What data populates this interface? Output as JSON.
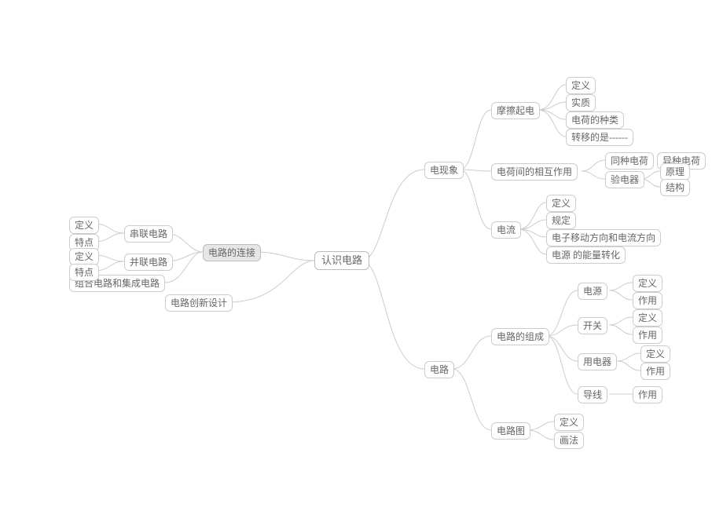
{
  "root": {
    "label": "认识电路"
  },
  "left": {
    "connection": {
      "label": "电路的连接",
      "series": {
        "label": "串联电路",
        "def": "定义",
        "char": "特点"
      },
      "parallel": {
        "label": "并联电路",
        "def": "定义",
        "char": "特点"
      },
      "combo": "组合电路和集成电路"
    },
    "innovate": "电路创新设计"
  },
  "right": {
    "phenomena": {
      "label": "电现象",
      "friction": {
        "label": "摩擦起电",
        "a": "定义",
        "b": "实质",
        "c": "电荷的种类",
        "d": "转移的是------"
      },
      "interaction": {
        "label": "电荷间的相互作用",
        "samecharge": "同种电荷",
        "diffcharge": "异种电荷",
        "electroscope": {
          "label": "验电器",
          "principle": "原理",
          "structure": "结构"
        }
      },
      "current": {
        "label": "电流",
        "a": "定义",
        "b": "规定",
        "c": "电子移动方向和电流方向",
        "d": "电源 的能量转化"
      }
    },
    "circuit": {
      "label": "电路",
      "composition": {
        "label": "电路的组成",
        "source": {
          "label": "电源",
          "def": "定义",
          "role": "作用"
        },
        "switch": {
          "label": "开关",
          "def": "定义",
          "role": "作用"
        },
        "device": {
          "label": "用电器",
          "def": "定义",
          "role": "作用"
        },
        "wire": {
          "label": "导线",
          "role": "作用"
        }
      },
      "diagram": {
        "label": "电路图",
        "a": "定义",
        "b": "画法"
      }
    }
  }
}
